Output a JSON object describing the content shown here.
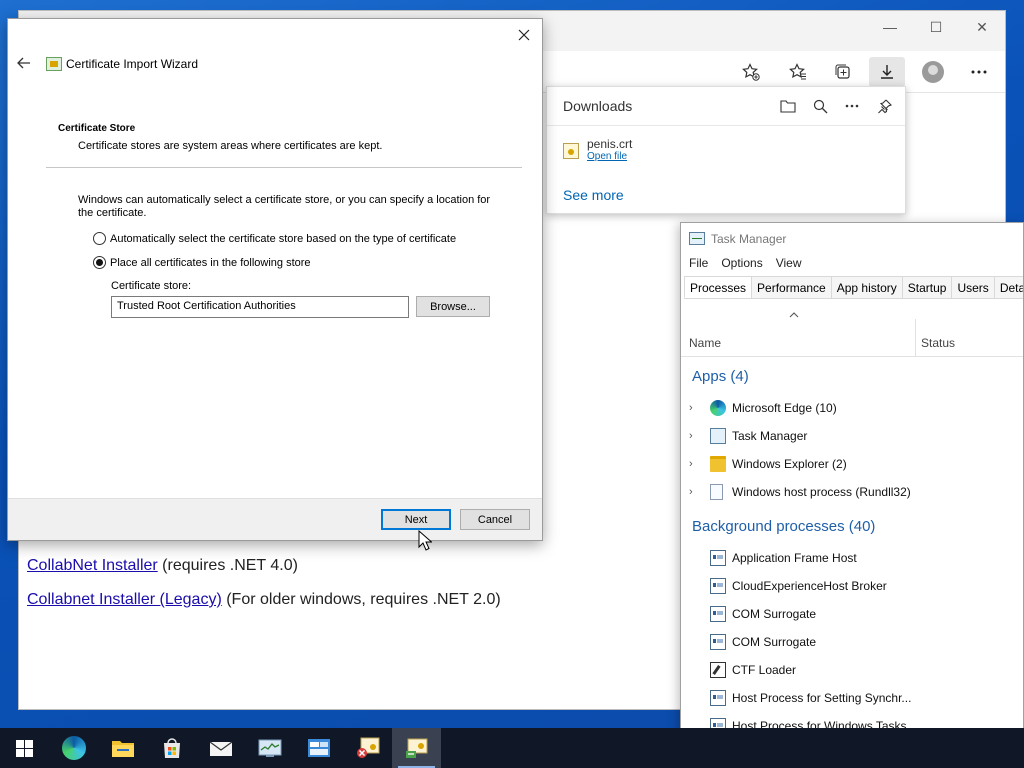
{
  "browser": {
    "window_controls": {
      "minimize": "—",
      "maximize": "☐",
      "close": "✕"
    },
    "links": [
      {
        "link_text": "CollabNet Installer",
        "suffix": " (requires .NET 4.0)"
      },
      {
        "link_text": "Collabnet Installer (Legacy)",
        "suffix": " (For older windows, requires .NET 2.0)"
      }
    ]
  },
  "downloads": {
    "title": "Downloads",
    "file_name": "penis.crt",
    "open_file": "Open file",
    "see_more": "See more"
  },
  "dialog": {
    "title": "Certificate Import Wizard",
    "section_title": "Certificate Store",
    "section_desc": "Certificate stores are system areas where certificates are kept.",
    "intro": "Windows can automatically select a certificate store, or you can specify a location for the certificate.",
    "radio_auto": "Automatically select the certificate store based on the type of certificate",
    "radio_place": "Place all certificates in the following store",
    "selected_radio": "place",
    "store_label": "Certificate store:",
    "store_value": "Trusted Root Certification Authorities",
    "browse": "Browse...",
    "next": "Next",
    "cancel": "Cancel"
  },
  "taskmgr": {
    "title": "Task Manager",
    "menu": [
      "File",
      "Options",
      "View"
    ],
    "tabs": [
      "Processes",
      "Performance",
      "App history",
      "Startup",
      "Users",
      "Detail"
    ],
    "active_tab": "Processes",
    "col_name": "Name",
    "col_status": "Status",
    "apps_header": "Apps (4)",
    "apps": [
      {
        "label": "Microsoft Edge (10)",
        "icon": "edge-icon"
      },
      {
        "label": "Task Manager",
        "icon": "task-manager-icon"
      },
      {
        "label": "Windows Explorer (2)",
        "icon": "folder-icon"
      },
      {
        "label": "Windows host process (Rundll32)",
        "icon": "file-icon"
      }
    ],
    "bg_header": "Background processes (40)",
    "bg": [
      {
        "label": "Application Frame Host",
        "icon": "process-icon"
      },
      {
        "label": "CloudExperienceHost Broker",
        "icon": "process-icon"
      },
      {
        "label": "COM Surrogate",
        "icon": "process-icon"
      },
      {
        "label": "COM Surrogate",
        "icon": "process-icon"
      },
      {
        "label": "CTF Loader",
        "icon": "ctf-icon"
      },
      {
        "label": "Host Process for Setting Synchr...",
        "icon": "process-icon"
      },
      {
        "label": "Host Process for Windows Tasks",
        "icon": "process-icon"
      }
    ]
  },
  "taskbar": {
    "items": [
      "start-icon",
      "edge-icon",
      "file-explorer-icon",
      "store-icon",
      "mail-icon",
      "task-manager-icon",
      "control-panel-icon",
      "certificate-error-icon",
      "certificate-wizard-icon"
    ],
    "active": "certificate-wizard-icon"
  }
}
